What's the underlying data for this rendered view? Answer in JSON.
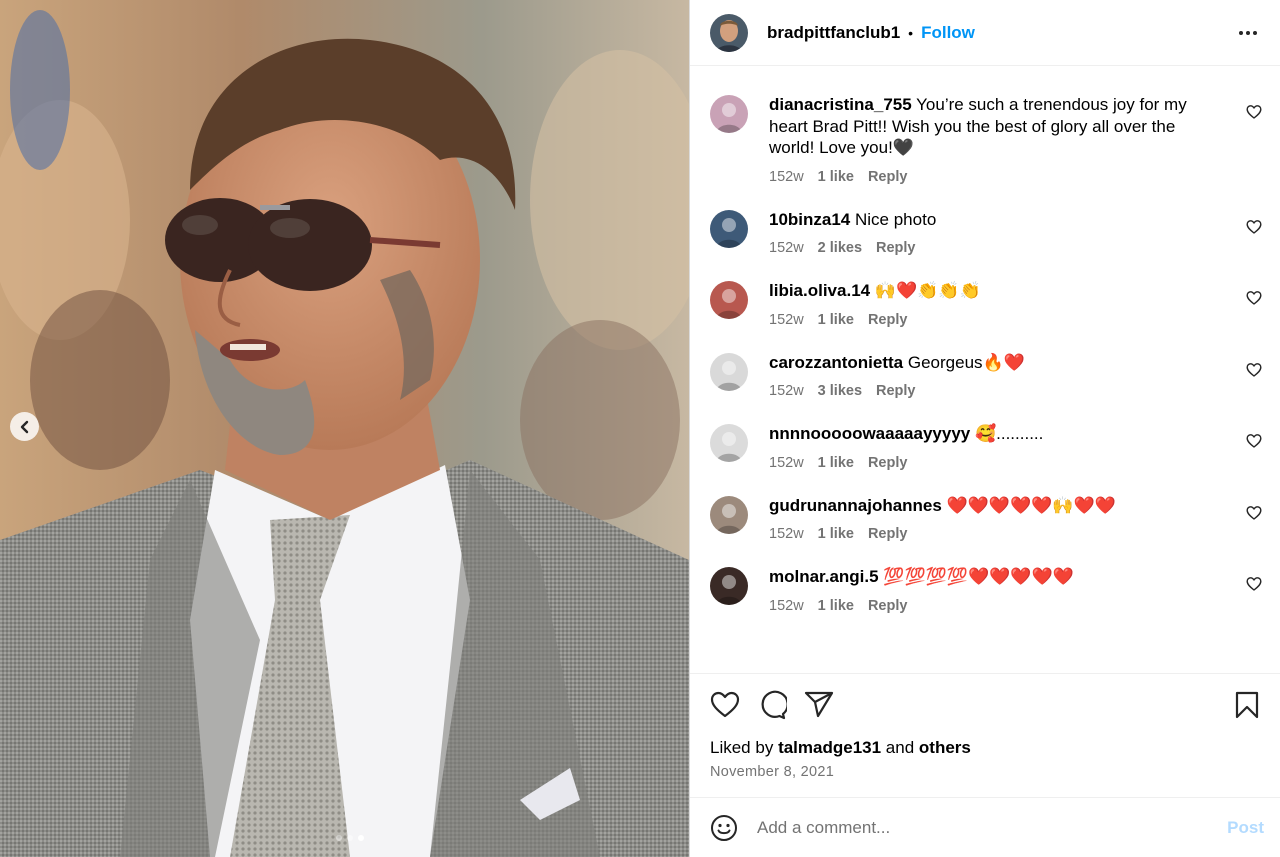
{
  "photo": {
    "carousel_total": 3,
    "carousel_active_index": 2,
    "prev_icon": "chevron-left-icon"
  },
  "header": {
    "username": "bradpittfanclub1",
    "separator": "•",
    "follow_label": "Follow",
    "more_icon": "more-horizontal-icon"
  },
  "comments": [
    {
      "username": "dianacristina_755",
      "text": "You’re such a trenendous joy for my heart Brad Pitt!! Wish you the best of glory all over the world! Love you!🖤",
      "time": "152w",
      "likes": "1 like",
      "reply": "Reply",
      "avatar_color": "#c9a2b6"
    },
    {
      "username": "10binza14",
      "text": "Nice photo",
      "time": "152w",
      "likes": "2 likes",
      "reply": "Reply",
      "avatar_color": "#3e5a78"
    },
    {
      "username": "libia.oliva.14",
      "text": "🙌❤️👏👏👏",
      "time": "152w",
      "likes": "1 like",
      "reply": "Reply",
      "avatar_color": "#b8584f"
    },
    {
      "username": "carozzantonietta",
      "text": "Georgeus🔥❤️",
      "time": "152w",
      "likes": "3 likes",
      "reply": "Reply",
      "avatar_color": "#d9d9d9"
    },
    {
      "username": "nnnnooooowaaaaayyyyy",
      "text": "🥰..........",
      "time": "152w",
      "likes": "1 like",
      "reply": "Reply",
      "avatar_color": "#dbdbdb"
    },
    {
      "username": "gudrunannajohannes",
      "text": "❤️❤️❤️❤️❤️🙌❤️❤️",
      "time": "152w",
      "likes": "1 like",
      "reply": "Reply",
      "avatar_color": "#9c8a7c"
    },
    {
      "username": "molnar.angi.5",
      "text": "💯💯💯💯❤️❤️❤️❤️❤️",
      "time": "152w",
      "likes": "1 like",
      "reply": "Reply",
      "avatar_color": "#3a2a26"
    }
  ],
  "actions": {
    "like_icon": "heart-icon",
    "comment_icon": "comment-icon",
    "share_icon": "share-icon",
    "save_icon": "bookmark-icon",
    "liked_by_prefix": "Liked by",
    "liked_by_user": "talmadge131",
    "liked_by_and": "and",
    "liked_by_others": "others",
    "date": "November 8, 2021"
  },
  "add_comment": {
    "emoji_icon": "smiley-icon",
    "placeholder": "Add a comment...",
    "post_label": "Post"
  },
  "colors": {
    "accent": "#0095f6",
    "post_disabled": "#b3dbff",
    "secondary_text": "#737373"
  }
}
